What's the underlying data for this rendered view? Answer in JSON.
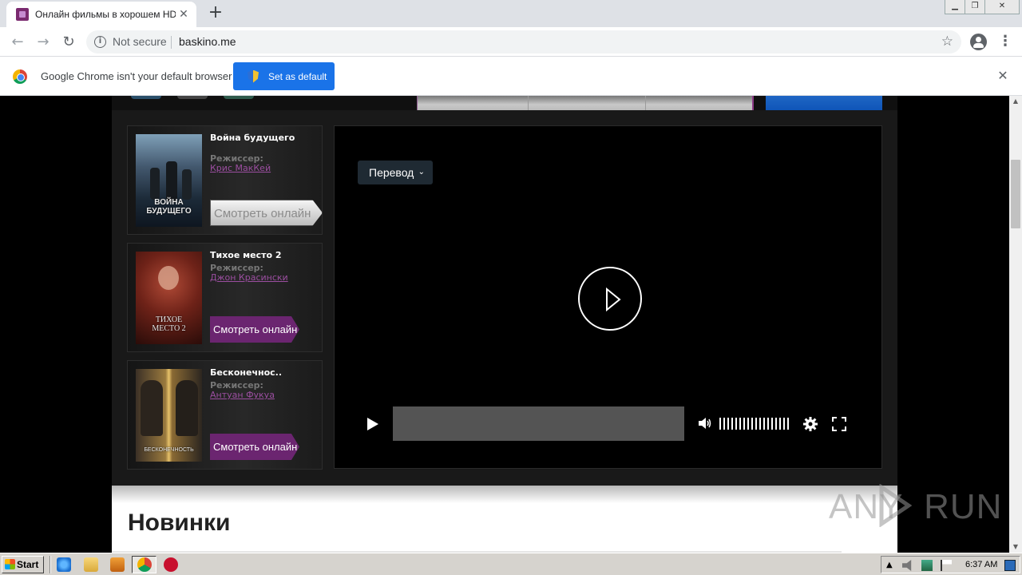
{
  "browser": {
    "tab_title": "Онлайн фильмы в хорошем HD кач",
    "tab_close": "✕",
    "new_tab": "+",
    "security_label": "Not secure",
    "url": "baskino.me"
  },
  "infobar": {
    "message": "Google Chrome isn't your default browser",
    "button_label": "Set as default",
    "close": "✕"
  },
  "movies": [
    {
      "title": "Война будущего",
      "meta_label": "Режиссер:",
      "director": "Крис МакКей",
      "watch_label": "Смотреть онлайн",
      "poster_title": "ВОЙНА\nБУДУЩЕГО",
      "button_style": "hover"
    },
    {
      "title": "Тихое место 2",
      "meta_label": "Режиссер:",
      "director": "Джон Красински",
      "watch_label": "Смотреть онлайн",
      "poster_title": "ТИХОЕ\nМЕСТО 2",
      "button_style": "normal"
    },
    {
      "title": "Бесконечнос..",
      "meta_label": "Режиссер:",
      "director": "Антуан Фукуа",
      "watch_label": "Смотреть онлайн",
      "poster_title": "БЕСКОНЕЧНОСТЬ",
      "button_style": "normal"
    }
  ],
  "player": {
    "translation_label": "Перевод",
    "translation_chevron": "⌄",
    "progress": 0
  },
  "section": {
    "title": "Новинки"
  },
  "watermark": {
    "text": "ANY  RUN"
  },
  "taskbar": {
    "start_label": "Start",
    "clock": "6:37 AM"
  },
  "colors": {
    "accent_purple": "#6b2570",
    "link_purple": "#9b4ea0",
    "chrome_blue": "#1a73e8"
  }
}
